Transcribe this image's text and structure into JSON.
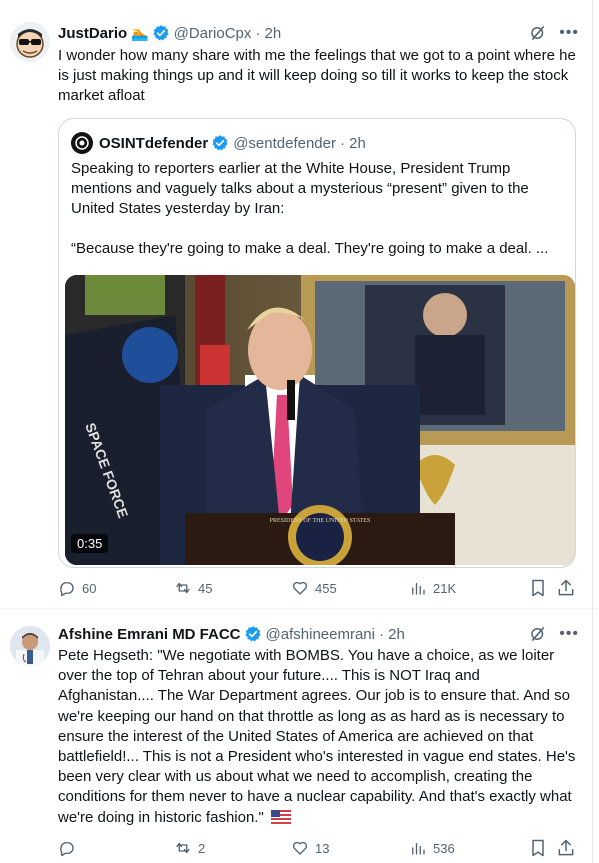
{
  "tweets": [
    {
      "author": {
        "name": "JustDario",
        "handle": "@DarioCpx",
        "time": "· 2h",
        "name_emoji": "🏊"
      },
      "text": "I wonder how many share with me the feelings that we got to a point where he is just making things up and it will keep doing so till it works to keep the stock market afloat",
      "quote": {
        "author": {
          "name": "OSINTdefender",
          "handle": "@sentdefender",
          "time": "· 2h"
        },
        "text_p1": "Speaking to reporters earlier at the White House, President Trump mentions and vaguely talks about a mysterious “present” given to the United States yesterday by Iran:",
        "text_p2": "“Because they're going to make a deal. They're going to make a deal. ...",
        "video": {
          "duration": "0:35",
          "flag_text": "SPACE FORCE",
          "seal_text": "PRESIDENT OF THE UNITED STATES"
        }
      },
      "stats": {
        "replies": "60",
        "reposts": "45",
        "likes": "455",
        "views": "21K"
      }
    },
    {
      "author": {
        "name": "Afshine Emrani MD FACC",
        "handle": "@afshineemrani",
        "time": "· 2h"
      },
      "text": "Pete Hegseth:   \"We negotiate with BOMBS. You have a choice, as we loiter over the top of Tehran about your future.... This is NOT Iraq and Afghanistan.... The War Department agrees. Our job is to ensure that. And so we're keeping our hand on that throttle as long as as hard as is necessary to ensure the interest of the United States of America are achieved on that battlefield!...    This is not a President who's interested in vague end states. He's been very clear with us about what we need to accomplish, creating the conditions for them never to have a nuclear capability. And that's exactly what we're doing in historic fashion.\"",
      "stats": {
        "replies": "",
        "reposts": "2",
        "likes": "13",
        "views": "536"
      }
    }
  ],
  "colors": {
    "text": "#0f1419",
    "secondary": "#536471",
    "verified": "#1d9bf0",
    "border": "#cfd9de"
  },
  "icons": [
    "grok-icon",
    "more-icon",
    "verified-icon",
    "reply-icon",
    "repost-icon",
    "like-icon",
    "views-icon",
    "bookmark-icon",
    "share-icon"
  ]
}
